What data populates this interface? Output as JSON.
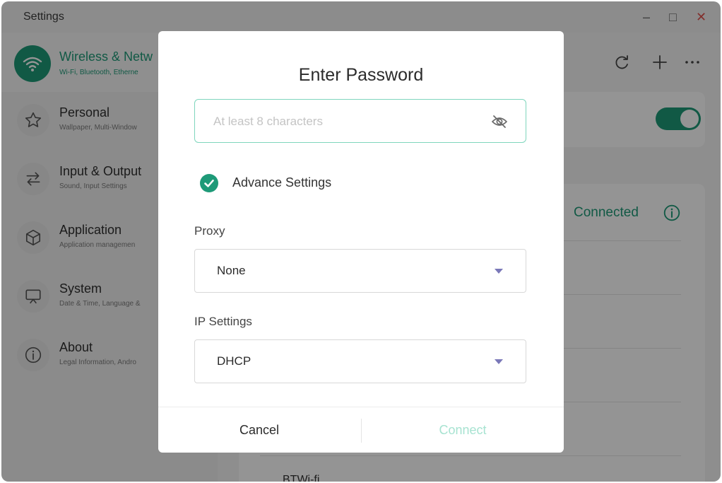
{
  "window": {
    "title": "Settings"
  },
  "sidebar": {
    "active": {
      "label": "Wireless & Netw",
      "sub": "Wi-Fi, Bluetooth, Etherne",
      "icon": "wifi-icon"
    },
    "items": [
      {
        "label": "Personal",
        "sub": "Wallpaper, Multi-Window",
        "icon": "star-icon"
      },
      {
        "label": "Input & Output",
        "sub": "Sound, Input Settings",
        "icon": "swap-arrows-icon"
      },
      {
        "label": "Application",
        "sub": "Application managemen",
        "icon": "cube-icon"
      },
      {
        "label": "System",
        "sub": "Date & Time, Language &",
        "icon": "monitor-icon"
      },
      {
        "label": "About",
        "sub": "Legal Information, Andro",
        "icon": "info-circle-icon"
      }
    ]
  },
  "main": {
    "status": "Connected",
    "partial_network": "BTWi-fi"
  },
  "dialog": {
    "title": "Enter Password",
    "password": {
      "placeholder": "At least 8 characters",
      "value": ""
    },
    "advance_settings": {
      "label": "Advance Settings",
      "checked": true
    },
    "proxy": {
      "label": "Proxy",
      "value": "None"
    },
    "ip_settings": {
      "label": "IP Settings",
      "value": "DHCP"
    },
    "buttons": {
      "cancel": "Cancel",
      "connect": "Connect"
    }
  },
  "colors": {
    "accent": "#1e9a78",
    "accent_light": "#a7e3d1",
    "overlay": "rgba(0,0,0,0.42)",
    "close": "#e0524d"
  }
}
